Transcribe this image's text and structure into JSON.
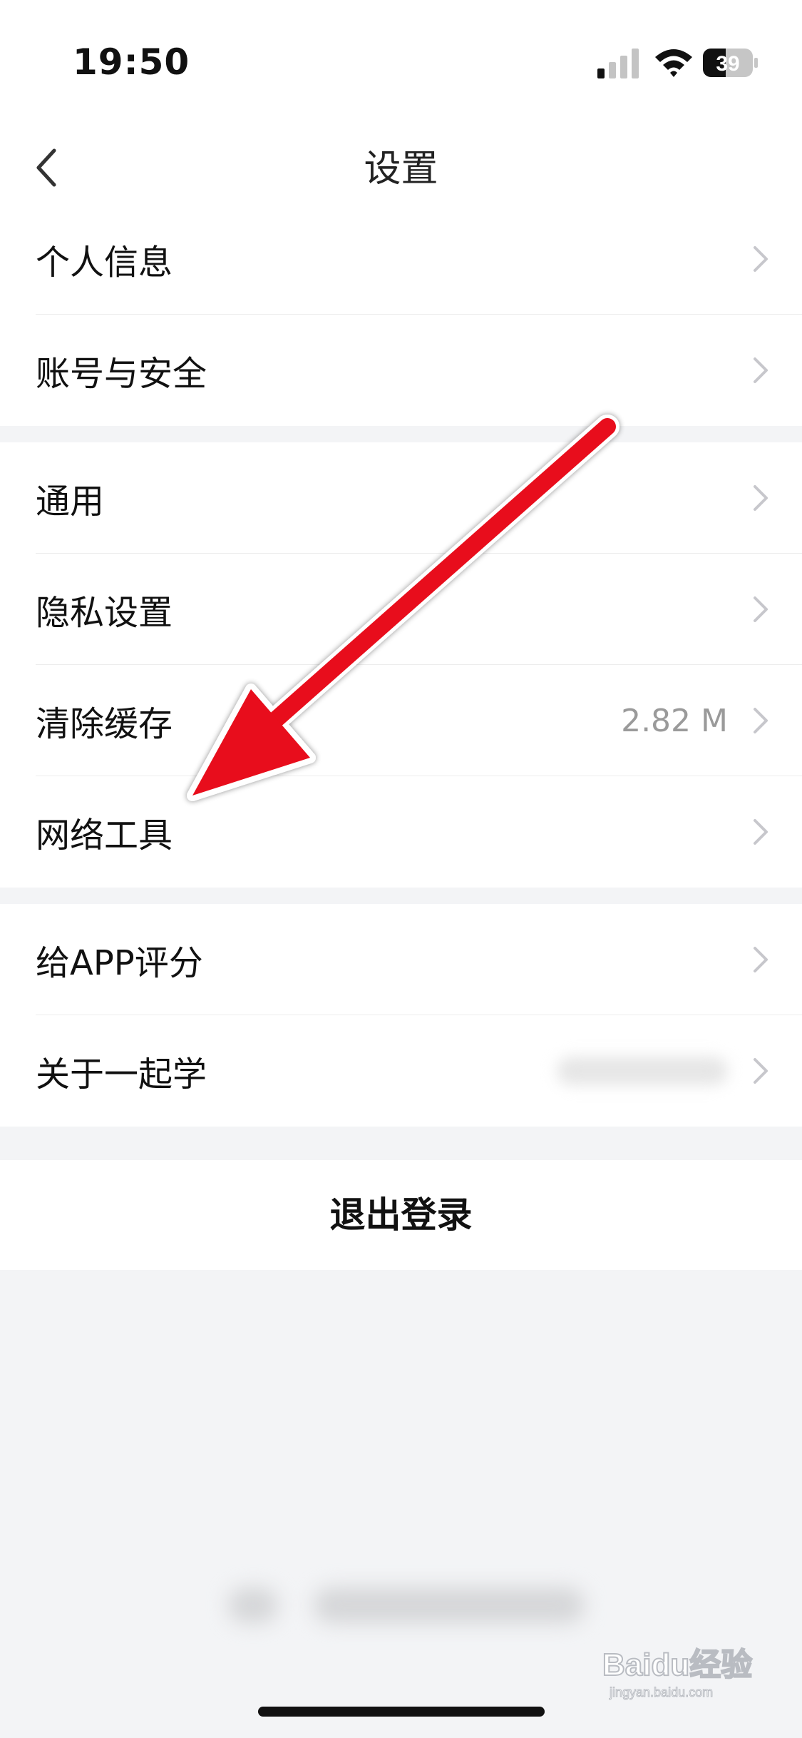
{
  "status_bar": {
    "time": "19:50",
    "battery": "39"
  },
  "nav": {
    "title": "设置"
  },
  "groups": [
    {
      "items": [
        {
          "label": "个人信息"
        },
        {
          "label": "账号与安全"
        }
      ]
    },
    {
      "items": [
        {
          "label": "通用"
        },
        {
          "label": "隐私设置"
        },
        {
          "label": "清除缓存",
          "value": "2.82 M"
        },
        {
          "label": "网络工具"
        }
      ]
    },
    {
      "items": [
        {
          "label": "给APP评分"
        },
        {
          "label": "关于一起学"
        }
      ]
    }
  ],
  "logout_label": "退出登录",
  "watermark": {
    "text": "Baidu经验",
    "sub": "jingyan.baidu.com"
  },
  "colors": {
    "arrow": "#e8111a",
    "background": "#f3f4f6",
    "chevron": "#c7c7cc"
  }
}
